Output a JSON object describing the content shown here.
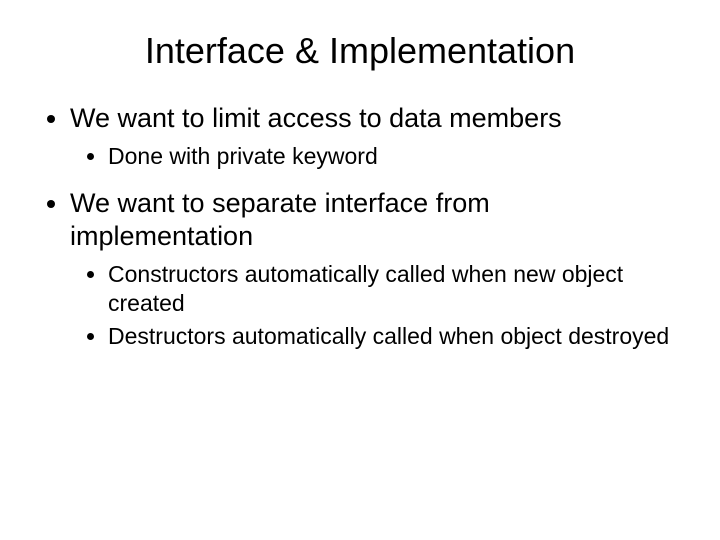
{
  "title": "Interface & Implementation",
  "bullets": [
    {
      "text": "We want to limit access to data members",
      "children": [
        {
          "text": "Done with private keyword"
        }
      ]
    },
    {
      "text": "We want to separate interface from implementation",
      "children": [
        {
          "text": "Constructors automatically called when new object created"
        },
        {
          "text": "Destructors automatically called when object destroyed"
        }
      ]
    }
  ]
}
